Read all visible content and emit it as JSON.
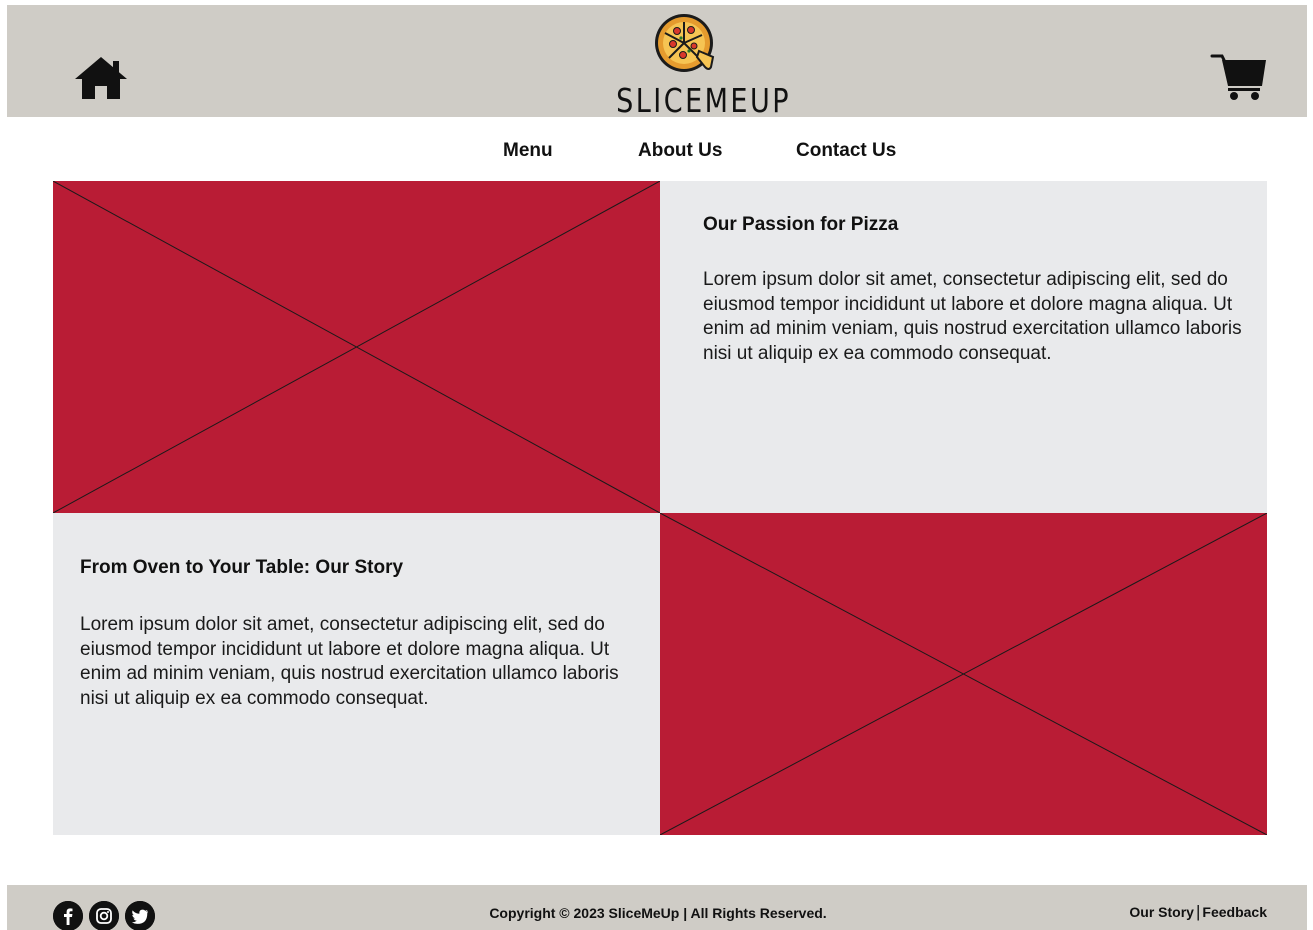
{
  "header": {
    "brand": "SLICEMEUP",
    "home_icon": "home-icon",
    "cart_icon": "shopping-cart-icon",
    "logo_icon": "pizza-icon"
  },
  "nav": {
    "items": [
      {
        "label": "Menu"
      },
      {
        "label": "About Us"
      },
      {
        "label": "Contact Us"
      }
    ]
  },
  "sections": [
    {
      "title": "Our Passion for Pizza",
      "body": "Lorem ipsum dolor sit amet, consectetur adipiscing elit, sed do eiusmod tempor incididunt ut labore et dolore magna aliqua. Ut enim ad minim veniam, quis nostrud exercitation ullamco laboris nisi ut aliquip ex ea commodo consequat."
    },
    {
      "title": "From Oven to Your Table: Our Story",
      "body": "Lorem ipsum dolor sit amet, consectetur adipiscing elit, sed do eiusmod tempor incididunt ut labore et dolore magna aliqua. Ut enim ad minim veniam, quis nostrud exercitation ullamco laboris nisi ut aliquip ex ea commodo consequat."
    }
  ],
  "footer": {
    "social_icons": [
      "facebook-icon",
      "instagram-icon",
      "twitter-icon"
    ],
    "copyright": "Copyright © 2023 SliceMeUp | All Rights Reserved.",
    "links": [
      {
        "label": "Our Story"
      },
      {
        "label": "Feedback"
      }
    ],
    "link_separator": "|"
  },
  "colors": {
    "header_bg": "#cfccc6",
    "image_placeholder": "#b91c35",
    "text_panel_bg": "#e9eaec",
    "text": "#111111"
  }
}
